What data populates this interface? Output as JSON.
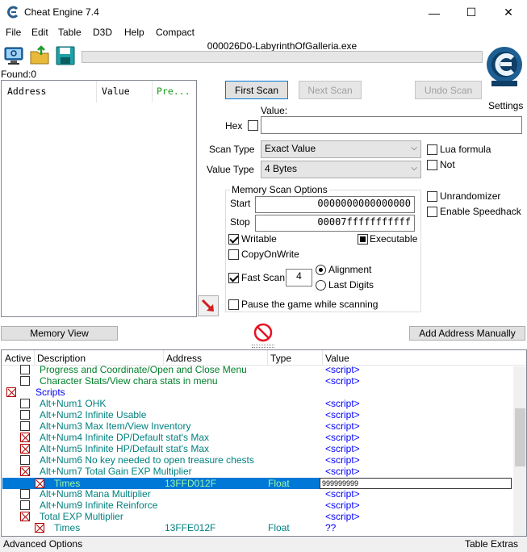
{
  "window": {
    "title": "Cheat Engine 7.4",
    "minimize": "—",
    "maximize": "☐",
    "close": "✕"
  },
  "menu": [
    "File",
    "Edit",
    "Table",
    "D3D",
    "Help",
    "Compact"
  ],
  "toolbar": {
    "process_name": "000026D0-LabyrinthOfGalleria.exe",
    "settings_label": "Settings"
  },
  "found_label": "Found:0",
  "result_list": {
    "headers": [
      "Address",
      "Value",
      "Pre..."
    ]
  },
  "scan": {
    "first_scan": "First Scan",
    "next_scan": "Next Scan",
    "undo_scan": "Undo Scan",
    "value_label": "Value:",
    "value": "",
    "hex_label": "Hex",
    "scan_type_label": "Scan Type",
    "scan_type": "Exact Value",
    "value_type_label": "Value Type",
    "value_type": "4 Bytes",
    "lua_formula": "Lua formula",
    "not": "Not",
    "memory_group": "Memory Scan Options",
    "start_label": "Start",
    "start_value": "0000000000000000",
    "stop_label": "Stop",
    "stop_value": "00007fffffffffff",
    "writable": "Writable",
    "executable": "Executable",
    "copy_on_write": "CopyOnWrite",
    "fast_scan": "Fast Scan",
    "fast_scan_value": "4",
    "alignment": "Alignment",
    "last_digits": "Last Digits",
    "pause_game": "Pause the game while scanning",
    "unrandomizer": "Unrandomizer",
    "enable_speedhack": "Enable Speedhack"
  },
  "buttons": {
    "memory_view": "Memory View",
    "add_address": "Add Address Manually"
  },
  "table": {
    "headers": {
      "active": "Active",
      "description": "Description",
      "address": "Address",
      "type": "Type",
      "value": "Value"
    },
    "rows": [
      {
        "desc": "Progress and Coordinate/Open and Close Menu",
        "address": "",
        "type": "",
        "value": "<script>",
        "checked": false
      },
      {
        "desc": "Character Stats/View chara stats in menu",
        "address": "",
        "type": "",
        "value": "<script>",
        "checked": false
      },
      {
        "desc": "Scripts",
        "address": "",
        "type": "",
        "value": "",
        "checked": true
      },
      {
        "desc": "Alt+Num1  OHK",
        "address": "",
        "type": "",
        "value": "<script>",
        "checked": false
      },
      {
        "desc": "Alt+Num2  Infinite Usable",
        "address": "",
        "type": "",
        "value": "<script>",
        "checked": false
      },
      {
        "desc": "Alt+Num3  Max Item/View Inventory",
        "address": "",
        "type": "",
        "value": "<script>",
        "checked": false
      },
      {
        "desc": "Alt+Num4  Infinite DP/Default stat's Max",
        "address": "",
        "type": "",
        "value": "<script>",
        "checked": true
      },
      {
        "desc": "Alt+Num5  Infinite HP/Default stat's Max",
        "address": "",
        "type": "",
        "value": "<script>",
        "checked": true
      },
      {
        "desc": "Alt+Num6  No key needed to open treasure chests",
        "address": "",
        "type": "",
        "value": "<script>",
        "checked": false
      },
      {
        "desc": "Alt+Num7  Total Gain EXP Multiplier",
        "address": "",
        "type": "",
        "value": "<script>",
        "checked": true
      },
      {
        "desc": "Times",
        "address": "13FFD012F",
        "type": "Float",
        "value": "999999999",
        "checked": true
      },
      {
        "desc": "Alt+Num8  Mana Multiplier",
        "address": "",
        "type": "",
        "value": "<script>",
        "checked": false
      },
      {
        "desc": "Alt+Num9  Infinite Reinforce",
        "address": "",
        "type": "",
        "value": "<script>",
        "checked": false
      },
      {
        "desc": "Total EXP Multiplier",
        "address": "",
        "type": "",
        "value": "<script>",
        "checked": true
      },
      {
        "desc": "Times",
        "address": "13FFE012F",
        "type": "Float",
        "value": "??",
        "checked": true
      }
    ]
  },
  "status": {
    "advanced_options": "Advanced Options",
    "table_extras": "Table Extras"
  },
  "colors": {
    "accent": "#0078d7",
    "script_text": "#0000ff",
    "desc_text": "#00802b",
    "stop_red": "#e81123"
  }
}
